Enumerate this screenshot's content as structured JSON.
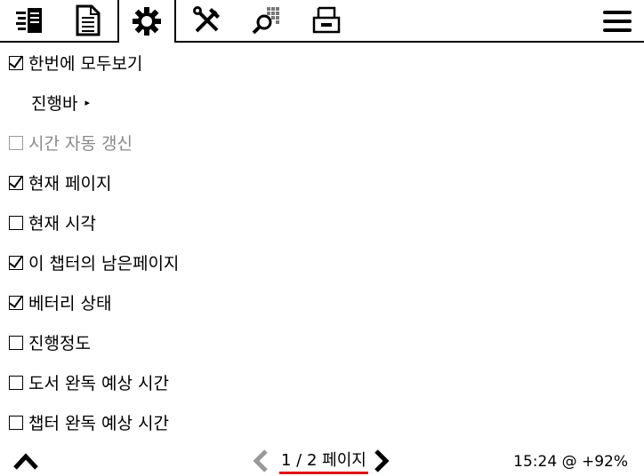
{
  "toolbar": {
    "tabs": [
      {
        "icon": "book-list-icon"
      },
      {
        "icon": "document-icon"
      },
      {
        "icon": "gear-icon",
        "active": true
      },
      {
        "icon": "tools-icon"
      },
      {
        "icon": "search-grid-icon"
      },
      {
        "icon": "storage-box-icon"
      }
    ],
    "menu_icon": "hamburger-menu-icon"
  },
  "menu": {
    "items": [
      {
        "label": "한번에 모두보기",
        "checked": true
      },
      {
        "label": "진행바",
        "submenu": true,
        "arrow": "▸"
      },
      {
        "label": "시간 자동 갱신",
        "checked": false,
        "disabled": true
      },
      {
        "label": "현재 페이지",
        "checked": true
      },
      {
        "label": "현재 시각",
        "checked": false
      },
      {
        "label": "이 챕터의 남은페이지",
        "checked": true
      },
      {
        "label": "베터리 상태",
        "checked": true
      },
      {
        "label": "진행정도",
        "checked": false
      },
      {
        "label": "도서 완독 예상 시간",
        "checked": false
      },
      {
        "label": "챕터 완독 예상 시간",
        "checked": false
      }
    ]
  },
  "footer": {
    "page_label": "1 / 2 페이지",
    "status": "15:24 @ +92%",
    "accent_color": "#e01010"
  }
}
